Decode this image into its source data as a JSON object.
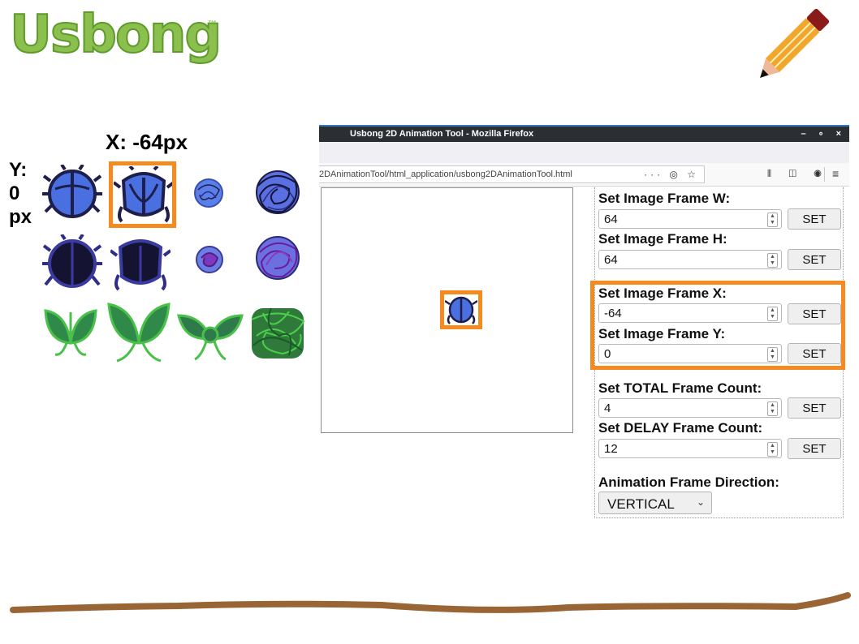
{
  "logo": {
    "text": "Usbong",
    "tm": "™"
  },
  "sprite_sheet": {
    "x_label": "X: -64px",
    "y_label_line1": "Y:",
    "y_label_line2": "0",
    "y_label_line3": "px"
  },
  "browser": {
    "window_title": "Usbong 2D Animation Tool - Mozilla Firefox",
    "window_controls": "– ∘ ×",
    "url": "2DAnimationTool/html_application/usbong2DAnimationTool.html",
    "url_icons": "··· ◎ ☆",
    "toolbar_icons": "⫴ ◫ ◉",
    "menu_icon": "≡"
  },
  "controls": {
    "frame_w_label": "Set Image Frame W:",
    "frame_w_value": "64",
    "frame_h_label": "Set Image Frame H:",
    "frame_h_value": "64",
    "frame_x_label": "Set Image Frame X:",
    "frame_x_value": "-64",
    "frame_y_label": "Set Image Frame Y:",
    "frame_y_value": "0",
    "total_label": "Set TOTAL Frame Count:",
    "total_value": "4",
    "delay_label": "Set DELAY Frame Count:",
    "delay_value": "12",
    "set_button": "SET",
    "direction_label": "Animation Frame Direction:",
    "direction_value": "VERTICAL"
  },
  "colors": {
    "highlight": "#f58a1f",
    "logo_green": "#8cc04e",
    "beetle_blue": "#4a6fe0",
    "beetle_dark": "#1e1e4a",
    "leaf_green": "#2f8a4a"
  }
}
